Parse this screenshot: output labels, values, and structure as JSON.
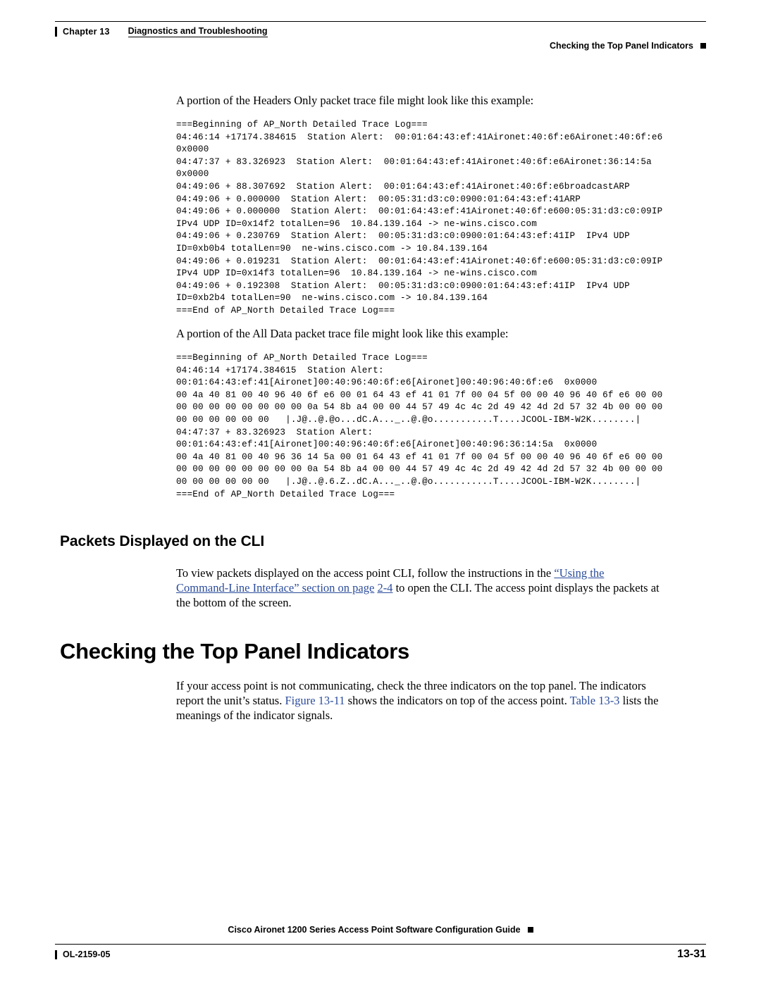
{
  "header": {
    "chapter_label": "Chapter 13",
    "chapter_title": "Diagnostics and Troubleshooting",
    "running_head": "Checking the Top Panel Indicators"
  },
  "content": {
    "intro_headers_only": "A portion of the Headers Only packet trace file might look like this example:",
    "code_headers_only": "===Beginning of AP_North Detailed Trace Log===\n04:46:14 +17174.384615  Station Alert:  00:01:64:43:ef:41Aironet:40:6f:e6Aironet:40:6f:e6\n0x0000\n04:47:37 + 83.326923  Station Alert:  00:01:64:43:ef:41Aironet:40:6f:e6Aironet:36:14:5a\n0x0000\n04:49:06 + 88.307692  Station Alert:  00:01:64:43:ef:41Aironet:40:6f:e6broadcastARP\n04:49:06 + 0.000000  Station Alert:  00:05:31:d3:c0:0900:01:64:43:ef:41ARP\n04:49:06 + 0.000000  Station Alert:  00:01:64:43:ef:41Aironet:40:6f:e600:05:31:d3:c0:09IP\nIPv4 UDP ID=0x14f2 totalLen=96  10.84.139.164 -> ne-wins.cisco.com\n04:49:06 + 0.230769  Station Alert:  00:05:31:d3:c0:0900:01:64:43:ef:41IP  IPv4 UDP\nID=0xb0b4 totalLen=90  ne-wins.cisco.com -> 10.84.139.164\n04:49:06 + 0.019231  Station Alert:  00:01:64:43:ef:41Aironet:40:6f:e600:05:31:d3:c0:09IP\nIPv4 UDP ID=0x14f3 totalLen=96  10.84.139.164 -> ne-wins.cisco.com\n04:49:06 + 0.192308  Station Alert:  00:05:31:d3:c0:0900:01:64:43:ef:41IP  IPv4 UDP\nID=0xb2b4 totalLen=90  ne-wins.cisco.com -> 10.84.139.164\n===End of AP_North Detailed Trace Log===",
    "intro_all_data": "A portion of the All Data packet trace file might look like this example:",
    "code_all_data": "===Beginning of AP_North Detailed Trace Log===\n04:46:14 +17174.384615  Station Alert:\n00:01:64:43:ef:41[Aironet]00:40:96:40:6f:e6[Aironet]00:40:96:40:6f:e6  0x0000\n00 4a 40 81 00 40 96 40 6f e6 00 01 64 43 ef 41 01 7f 00 04 5f 00 00 40 96 40 6f e6 00 00\n00 00 00 00 00 00 00 00 0a 54 8b a4 00 00 44 57 49 4c 4c 2d 49 42 4d 2d 57 32 4b 00 00 00\n00 00 00 00 00 00   |.J@..@.@o...dC.A..._..@.@o...........T....JCOOL-IBM-W2K........|\n04:47:37 + 83.326923  Station Alert:\n00:01:64:43:ef:41[Aironet]00:40:96:40:6f:e6[Aironet]00:40:96:36:14:5a  0x0000\n00 4a 40 81 00 40 96 36 14 5a 00 01 64 43 ef 41 01 7f 00 04 5f 00 00 40 96 40 6f e6 00 00\n00 00 00 00 00 00 00 00 0a 54 8b a4 00 00 44 57 49 4c 4c 2d 49 42 4d 2d 57 32 4b 00 00 00\n00 00 00 00 00 00   |.J@..@.6.Z..dC.A..._..@.@o...........T....JCOOL-IBM-W2K........|\n===End of AP_North Detailed Trace Log===",
    "heading_packets_cli": "Packets Displayed on the CLI",
    "para_cli_1": "To view packets displayed on the access point CLI, follow the instructions in the ",
    "para_cli_link_1": "“Using the",
    "para_cli_link_2": "Command-Line Interface” section on page",
    "para_cli_link_3": "2-4",
    "para_cli_2": " to open the CLI. The access point displays the packets at",
    "para_cli_3": "the bottom of the screen.",
    "heading_checking": "Checking the Top Panel Indicators",
    "para_checking_1": "If your access point is not communicating, check the three indicators on the top panel. The indicators",
    "para_checking_2a": "report the unit’s status. ",
    "para_checking_link_figure": "Figure 13-11",
    "para_checking_2b": " shows the indicators on top of the access point. ",
    "para_checking_link_table": "Table 13-3",
    "para_checking_2c": " lists the",
    "para_checking_3": "meanings of the indicator signals."
  },
  "footer": {
    "guide_title": "Cisco Aironet 1200 Series Access Point Software Configuration Guide",
    "doc_number": "OL-2159-05",
    "page_number": "13-31"
  }
}
